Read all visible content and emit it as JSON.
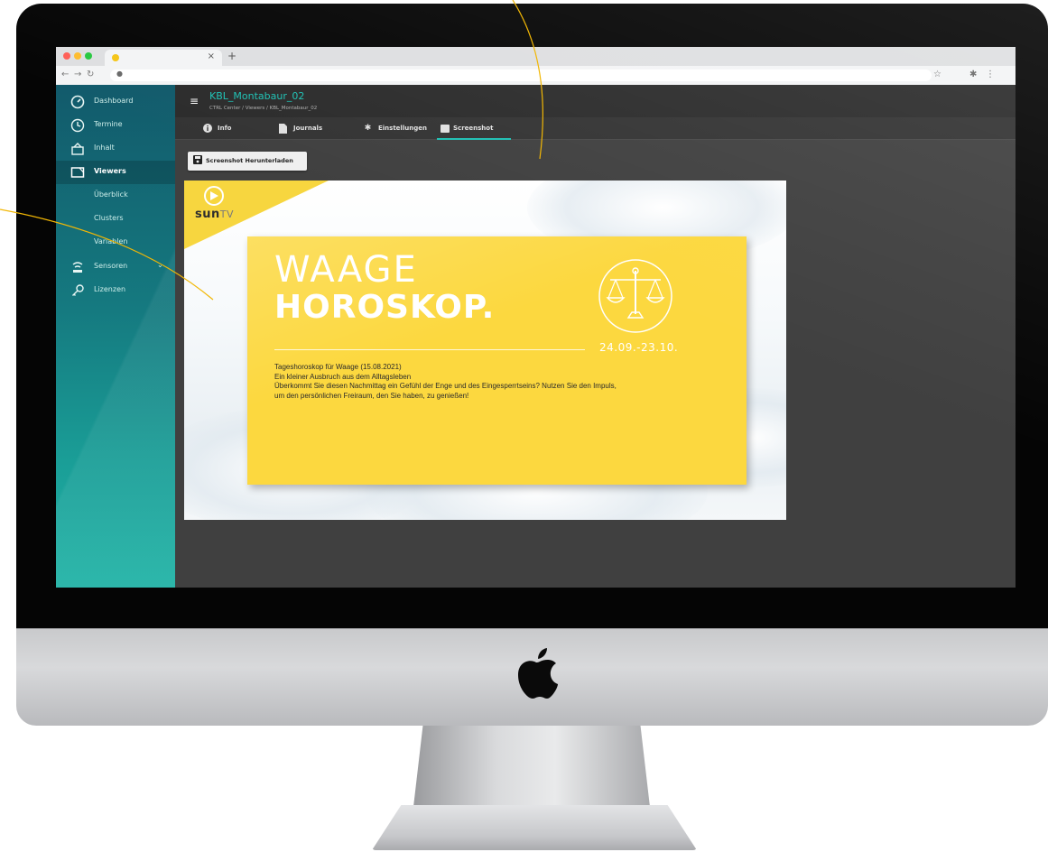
{
  "browser": {
    "new_tab_glyph": "+",
    "close_glyph": "×"
  },
  "header": {
    "title": "KBL_Montabaur_02",
    "breadcrumb": "CTRL Center / Viewers / KBL_Montabaur_02"
  },
  "sidebar": {
    "items": [
      {
        "label": "Dashboard",
        "icon": "gauge-icon"
      },
      {
        "label": "Termine",
        "icon": "clock-icon"
      },
      {
        "label": "Inhalt",
        "icon": "content-icon"
      },
      {
        "label": "Viewers",
        "icon": "monitor-icon"
      },
      {
        "label": "Sensoren",
        "icon": "sensor-icon"
      },
      {
        "label": "Lizenzen",
        "icon": "key-icon"
      }
    ],
    "subitems": [
      "Überblick",
      "Clusters",
      "Variablen"
    ]
  },
  "tabs": [
    {
      "label": "Info",
      "icon": "info-icon"
    },
    {
      "label": "Journals",
      "icon": "file-icon"
    },
    {
      "label": "Einstellungen",
      "icon": "gear-icon"
    },
    {
      "label": "Screenshot",
      "icon": "image-icon"
    }
  ],
  "actions": {
    "download_label": "Screenshot Herunterladen"
  },
  "preview": {
    "brand_main": "sun",
    "brand_suffix": "TV",
    "title_line1": "WAAGE",
    "title_line2": "HOROSKOP.",
    "date_range": "24.09.-23.10.",
    "text_lines": [
      "Tageshoroskop für Waage (15.08.2021)",
      "Ein kleiner Ausbruch aus dem Alltagsleben",
      "Überkommt Sie diesen Nachmittag ein Gefühl der Enge und des Eingesperrtseins? Nutzen Sie den Impuls,",
      "um den persönlichen Freiraum, den Sie haben, zu genießen!"
    ]
  },
  "colors": {
    "accent": "#1fc1b4",
    "card_yellow": "#fcd83f",
    "callout_line": "#f2b705"
  }
}
